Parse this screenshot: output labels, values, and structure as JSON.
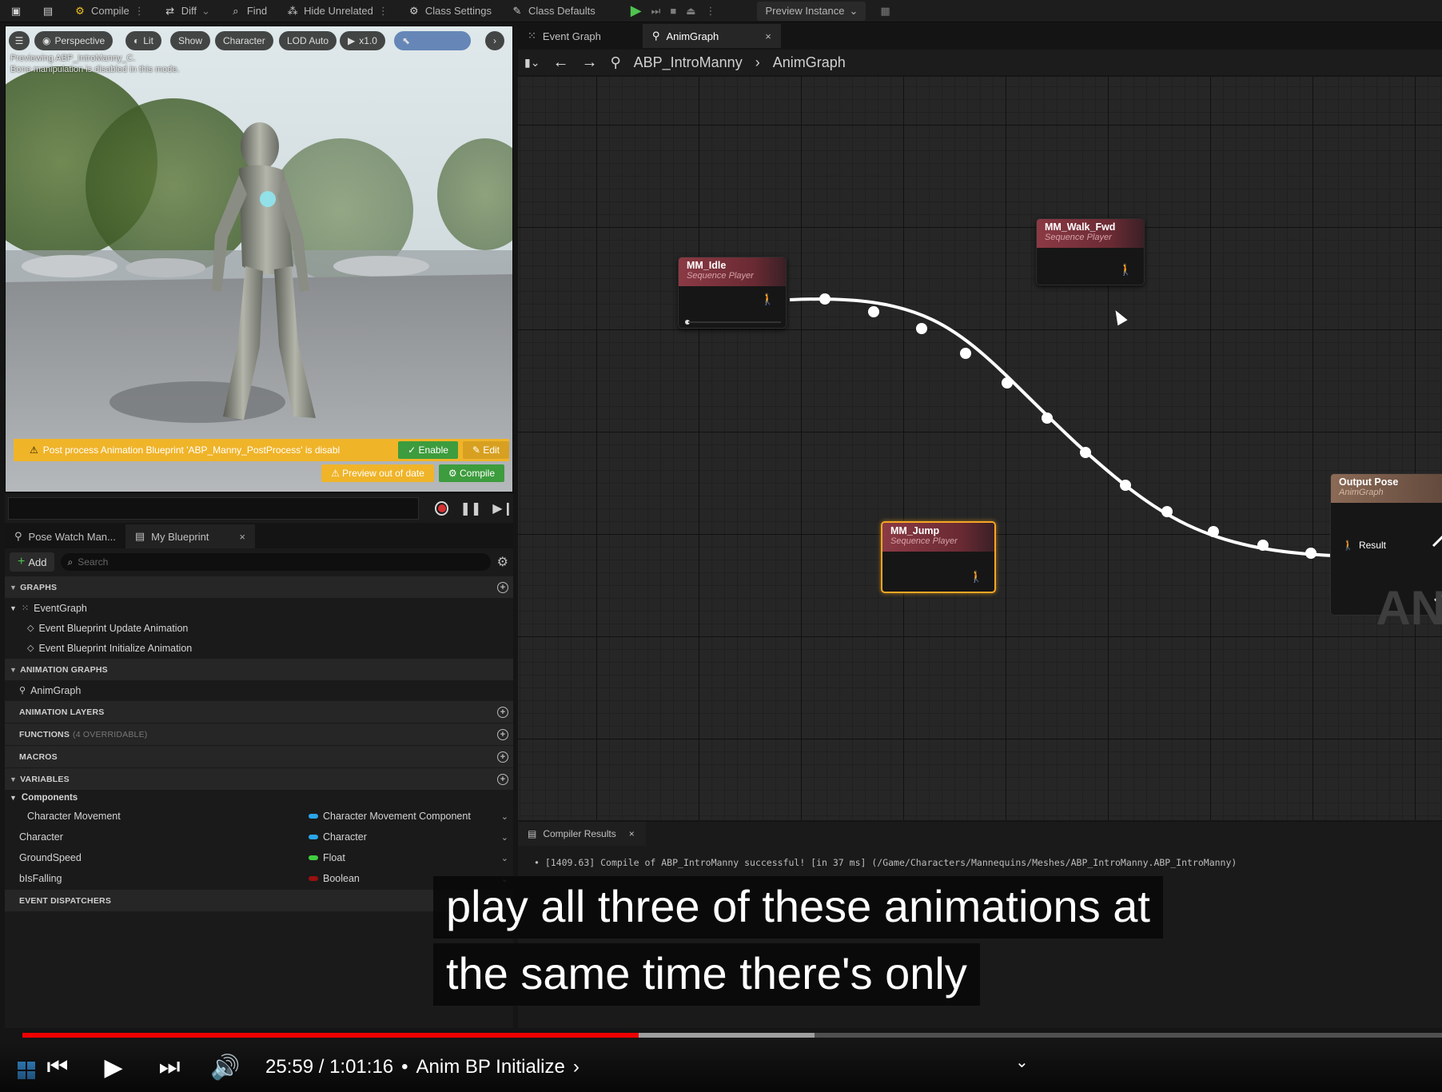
{
  "toolbar": {
    "compile": "Compile",
    "diff": "Diff",
    "find": "Find",
    "hide_unrelated": "Hide Unrelated",
    "class_settings": "Class Settings",
    "class_defaults": "Class Defaults",
    "preview_instance": "Preview Instance"
  },
  "viewport": {
    "perspective": "Perspective",
    "lit": "Lit",
    "show": "Show",
    "character": "Character",
    "lod": "LOD Auto",
    "speed": "x1.0",
    "previewing": "Previewing ABP_IntroManny_C.",
    "bone_note": "Bone manipulation is disabled in this mode.",
    "warning": "Post process Animation Blueprint 'ABP_Manny_PostProcess' is disabl",
    "enable": "Enable",
    "edit": "Edit",
    "preview_out_of_date": "Preview out of date",
    "compile": "Compile"
  },
  "bp_panel": {
    "tab_pose_watch": "Pose Watch Man...",
    "tab_my_blueprint": "My Blueprint",
    "add": "Add",
    "search_placeholder": "Search",
    "graphs": "GRAPHS",
    "event_graph": "EventGraph",
    "event_update": "Event Blueprint Update Animation",
    "event_init": "Event Blueprint Initialize Animation",
    "anim_graphs": "ANIMATION GRAPHS",
    "anim_graph": "AnimGraph",
    "anim_layers": "ANIMATION LAYERS",
    "functions": "FUNCTIONS",
    "functions_sub": "(4 OVERRIDABLE)",
    "macros": "MACROS",
    "variables": "VARIABLES",
    "components": "Components",
    "vars": [
      {
        "name": "Character Movement",
        "type": "Character Movement Component",
        "color": "#2aa5e8"
      },
      {
        "name": "Character",
        "type": "Character",
        "color": "#2aa5e8"
      },
      {
        "name": "GroundSpeed",
        "type": "Float",
        "color": "#3fcf3f"
      },
      {
        "name": "bIsFalling",
        "type": "Boolean",
        "color": "#9a1010"
      }
    ],
    "event_dispatchers": "EVENT DISPATCHERS"
  },
  "graph": {
    "tab_event_graph": "Event Graph",
    "tab_anim_graph": "AnimGraph",
    "bc_blueprint": "ABP_IntroManny",
    "bc_graph": "AnimGraph",
    "nodes": {
      "idle": {
        "title": "MM_Idle",
        "subtitle": "Sequence Player"
      },
      "walk": {
        "title": "MM_Walk_Fwd",
        "subtitle": "Sequence Player"
      },
      "jump": {
        "title": "MM_Jump",
        "subtitle": "Sequence Player"
      },
      "output": {
        "title": "Output Pose",
        "subtitle": "AnimGraph",
        "pin": "Result"
      }
    },
    "watermark": "AN"
  },
  "compiler": {
    "tab": "Compiler Results",
    "message": "[1409.63] Compile of ABP_IntroManny successful! [in 37 ms] (/Game/Characters/Mannequins/Meshes/ABP_IntroManny.ABP_IntroManny)"
  },
  "caption": {
    "line1": "play all three of these animations at",
    "line2": "the same time there's only"
  },
  "player": {
    "time": "25:59 / 1:01:16",
    "chapter": "Anim BP Initialize",
    "progress": 0.434,
    "buffered": 0.558
  }
}
